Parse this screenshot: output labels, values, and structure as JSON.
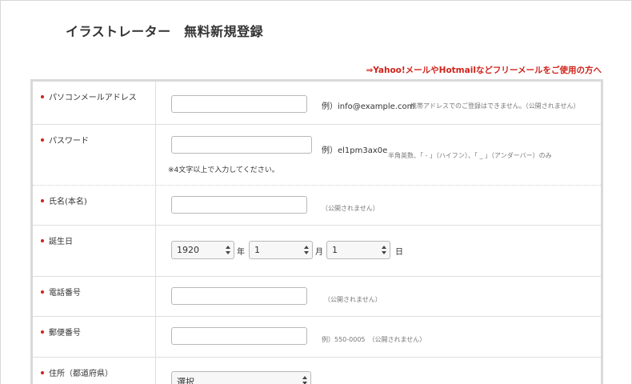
{
  "page": {
    "title": "イラストレーター　無料新規登録",
    "free_mail_link": "⇒Yahoo!メールやHotmailなどフリーメールをご使用の方へ"
  },
  "form": {
    "email": {
      "label": "パソコンメールアドレス",
      "value": "",
      "example": "例）info@example.com",
      "note": "携帯アドレスでのご登録はできません。（公開されません）"
    },
    "password": {
      "label": "パスワード",
      "value": "",
      "example": "例）el1pm3ax0e",
      "note": "半角英数、「 - 」（ハイフン）、「 _ 」（アンダーバー）のみ",
      "sub_note": "※4文字以上で入力してください。"
    },
    "name": {
      "label": "氏名(本名)",
      "value": "",
      "note": "（公開されません）"
    },
    "birthday": {
      "label": "誕生日",
      "year_value": "1920",
      "year_unit": "年",
      "month_value": "1",
      "month_unit": "月",
      "day_value": "1",
      "day_unit": "日"
    },
    "phone": {
      "label": "電話番号",
      "value": "",
      "note": "（公開されません）"
    },
    "postal": {
      "label": "郵便番号",
      "value": "",
      "note": "例）550-0005　（公開されません）"
    },
    "prefecture": {
      "label": "住所（都道府県）",
      "selected": "選択"
    }
  },
  "colors": {
    "accent_red": "#d0231b",
    "border": "#d9d9d9"
  }
}
